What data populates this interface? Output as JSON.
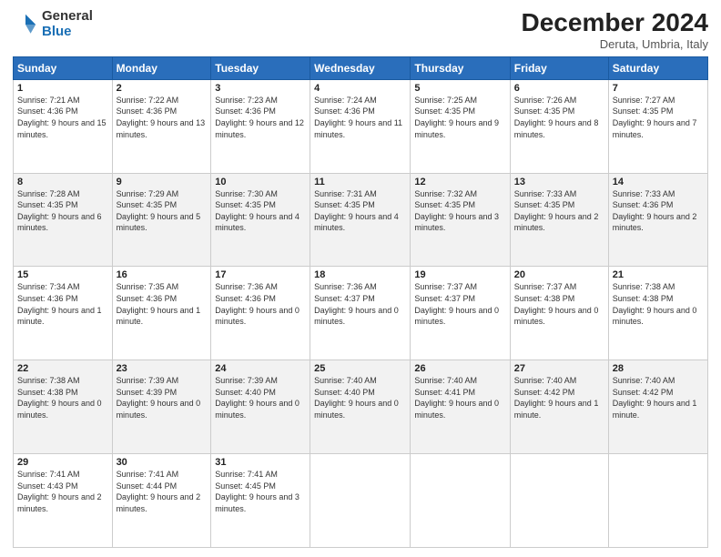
{
  "logo": {
    "general": "General",
    "blue": "Blue"
  },
  "title": "December 2024",
  "subtitle": "Deruta, Umbria, Italy",
  "days_of_week": [
    "Sunday",
    "Monday",
    "Tuesday",
    "Wednesday",
    "Thursday",
    "Friday",
    "Saturday"
  ],
  "weeks": [
    [
      {
        "num": "1",
        "sunrise": "Sunrise: 7:21 AM",
        "sunset": "Sunset: 4:36 PM",
        "daylight": "Daylight: 9 hours and 15 minutes."
      },
      {
        "num": "2",
        "sunrise": "Sunrise: 7:22 AM",
        "sunset": "Sunset: 4:36 PM",
        "daylight": "Daylight: 9 hours and 13 minutes."
      },
      {
        "num": "3",
        "sunrise": "Sunrise: 7:23 AM",
        "sunset": "Sunset: 4:36 PM",
        "daylight": "Daylight: 9 hours and 12 minutes."
      },
      {
        "num": "4",
        "sunrise": "Sunrise: 7:24 AM",
        "sunset": "Sunset: 4:36 PM",
        "daylight": "Daylight: 9 hours and 11 minutes."
      },
      {
        "num": "5",
        "sunrise": "Sunrise: 7:25 AM",
        "sunset": "Sunset: 4:35 PM",
        "daylight": "Daylight: 9 hours and 9 minutes."
      },
      {
        "num": "6",
        "sunrise": "Sunrise: 7:26 AM",
        "sunset": "Sunset: 4:35 PM",
        "daylight": "Daylight: 9 hours and 8 minutes."
      },
      {
        "num": "7",
        "sunrise": "Sunrise: 7:27 AM",
        "sunset": "Sunset: 4:35 PM",
        "daylight": "Daylight: 9 hours and 7 minutes."
      }
    ],
    [
      {
        "num": "8",
        "sunrise": "Sunrise: 7:28 AM",
        "sunset": "Sunset: 4:35 PM",
        "daylight": "Daylight: 9 hours and 6 minutes."
      },
      {
        "num": "9",
        "sunrise": "Sunrise: 7:29 AM",
        "sunset": "Sunset: 4:35 PM",
        "daylight": "Daylight: 9 hours and 5 minutes."
      },
      {
        "num": "10",
        "sunrise": "Sunrise: 7:30 AM",
        "sunset": "Sunset: 4:35 PM",
        "daylight": "Daylight: 9 hours and 4 minutes."
      },
      {
        "num": "11",
        "sunrise": "Sunrise: 7:31 AM",
        "sunset": "Sunset: 4:35 PM",
        "daylight": "Daylight: 9 hours and 4 minutes."
      },
      {
        "num": "12",
        "sunrise": "Sunrise: 7:32 AM",
        "sunset": "Sunset: 4:35 PM",
        "daylight": "Daylight: 9 hours and 3 minutes."
      },
      {
        "num": "13",
        "sunrise": "Sunrise: 7:33 AM",
        "sunset": "Sunset: 4:35 PM",
        "daylight": "Daylight: 9 hours and 2 minutes."
      },
      {
        "num": "14",
        "sunrise": "Sunrise: 7:33 AM",
        "sunset": "Sunset: 4:36 PM",
        "daylight": "Daylight: 9 hours and 2 minutes."
      }
    ],
    [
      {
        "num": "15",
        "sunrise": "Sunrise: 7:34 AM",
        "sunset": "Sunset: 4:36 PM",
        "daylight": "Daylight: 9 hours and 1 minute."
      },
      {
        "num": "16",
        "sunrise": "Sunrise: 7:35 AM",
        "sunset": "Sunset: 4:36 PM",
        "daylight": "Daylight: 9 hours and 1 minute."
      },
      {
        "num": "17",
        "sunrise": "Sunrise: 7:36 AM",
        "sunset": "Sunset: 4:36 PM",
        "daylight": "Daylight: 9 hours and 0 minutes."
      },
      {
        "num": "18",
        "sunrise": "Sunrise: 7:36 AM",
        "sunset": "Sunset: 4:37 PM",
        "daylight": "Daylight: 9 hours and 0 minutes."
      },
      {
        "num": "19",
        "sunrise": "Sunrise: 7:37 AM",
        "sunset": "Sunset: 4:37 PM",
        "daylight": "Daylight: 9 hours and 0 minutes."
      },
      {
        "num": "20",
        "sunrise": "Sunrise: 7:37 AM",
        "sunset": "Sunset: 4:38 PM",
        "daylight": "Daylight: 9 hours and 0 minutes."
      },
      {
        "num": "21",
        "sunrise": "Sunrise: 7:38 AM",
        "sunset": "Sunset: 4:38 PM",
        "daylight": "Daylight: 9 hours and 0 minutes."
      }
    ],
    [
      {
        "num": "22",
        "sunrise": "Sunrise: 7:38 AM",
        "sunset": "Sunset: 4:38 PM",
        "daylight": "Daylight: 9 hours and 0 minutes."
      },
      {
        "num": "23",
        "sunrise": "Sunrise: 7:39 AM",
        "sunset": "Sunset: 4:39 PM",
        "daylight": "Daylight: 9 hours and 0 minutes."
      },
      {
        "num": "24",
        "sunrise": "Sunrise: 7:39 AM",
        "sunset": "Sunset: 4:40 PM",
        "daylight": "Daylight: 9 hours and 0 minutes."
      },
      {
        "num": "25",
        "sunrise": "Sunrise: 7:40 AM",
        "sunset": "Sunset: 4:40 PM",
        "daylight": "Daylight: 9 hours and 0 minutes."
      },
      {
        "num": "26",
        "sunrise": "Sunrise: 7:40 AM",
        "sunset": "Sunset: 4:41 PM",
        "daylight": "Daylight: 9 hours and 0 minutes."
      },
      {
        "num": "27",
        "sunrise": "Sunrise: 7:40 AM",
        "sunset": "Sunset: 4:42 PM",
        "daylight": "Daylight: 9 hours and 1 minute."
      },
      {
        "num": "28",
        "sunrise": "Sunrise: 7:40 AM",
        "sunset": "Sunset: 4:42 PM",
        "daylight": "Daylight: 9 hours and 1 minute."
      }
    ],
    [
      {
        "num": "29",
        "sunrise": "Sunrise: 7:41 AM",
        "sunset": "Sunset: 4:43 PM",
        "daylight": "Daylight: 9 hours and 2 minutes."
      },
      {
        "num": "30",
        "sunrise": "Sunrise: 7:41 AM",
        "sunset": "Sunset: 4:44 PM",
        "daylight": "Daylight: 9 hours and 2 minutes."
      },
      {
        "num": "31",
        "sunrise": "Sunrise: 7:41 AM",
        "sunset": "Sunset: 4:45 PM",
        "daylight": "Daylight: 9 hours and 3 minutes."
      },
      null,
      null,
      null,
      null
    ]
  ]
}
